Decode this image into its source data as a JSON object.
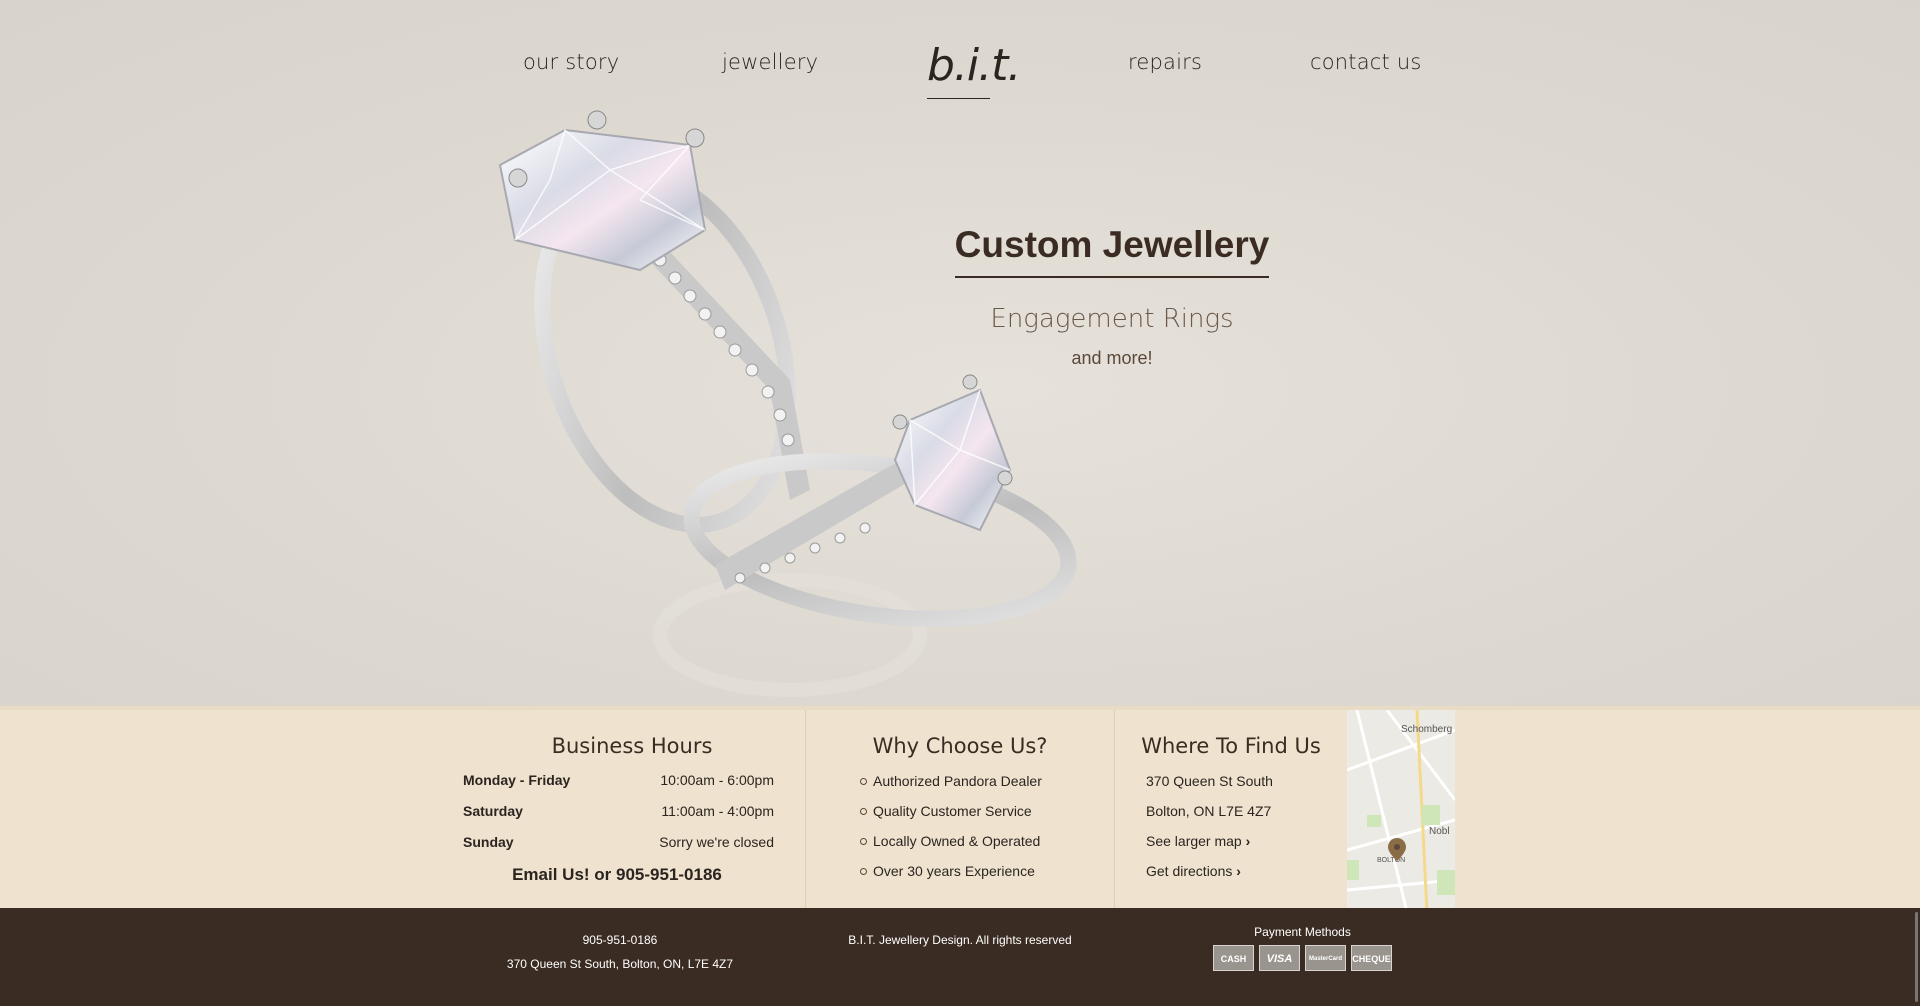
{
  "nav": {
    "items": [
      "our story",
      "jewellery",
      "repairs",
      "contact us"
    ],
    "logo_text": "b.i.t."
  },
  "promo": {
    "title": "Custom Jewellery",
    "subtitle": "Engagement Rings",
    "more": "and more!"
  },
  "hours": {
    "title": "Business Hours",
    "rows": [
      {
        "day": "Monday - Friday",
        "time": "10:00am - 6:00pm"
      },
      {
        "day": "Saturday",
        "time": "11:00am - 4:00pm"
      },
      {
        "day": "Sunday",
        "time": "Sorry we're closed"
      }
    ],
    "contact": "Email Us! or 905-951-0186"
  },
  "why": {
    "title": "Why Choose Us?",
    "items": [
      "Authorized Pandora Dealer",
      "Quality Customer Service",
      "Locally Owned & Operated",
      "Over 30 years Experience"
    ]
  },
  "find": {
    "title": "Where To Find Us",
    "address1": "370 Queen St South",
    "address2": "Bolton, ON L7E 4Z7",
    "map_link": "See larger map",
    "directions_link": "Get directions",
    "map_labels": [
      "Schomberg",
      "Nobl",
      "BOLTON"
    ]
  },
  "footer": {
    "phone": "905-951-0186",
    "address": "370 Queen St South, Bolton, ON, L7E 4Z7",
    "copyright": "B.I.T. Jewellery Design. All rights reserved",
    "payment_title": "Payment Methods",
    "payments": [
      "CASH",
      "VISA",
      "MasterCard",
      "CHEQUE"
    ]
  },
  "colors": {
    "hero_bg": "#ddd8d0",
    "info_bg": "#efe3cf",
    "footer_bg": "#3a2c22",
    "text_dark": "#3a2c22"
  }
}
